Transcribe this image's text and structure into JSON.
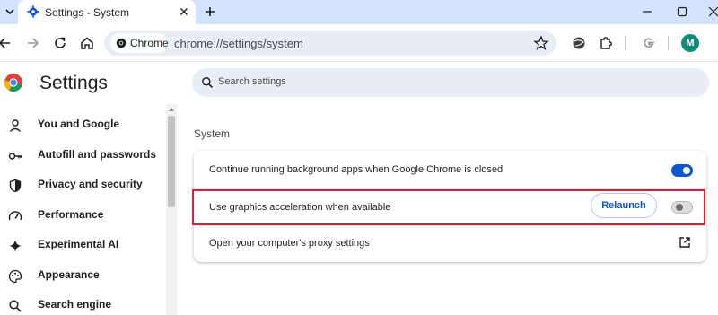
{
  "tab": {
    "title": "Settings - System"
  },
  "omnibox": {
    "chip_label": "Chrome",
    "url": "chrome://settings/system"
  },
  "profile": {
    "initial": "M"
  },
  "brand": {
    "title": "Settings"
  },
  "search": {
    "placeholder": "Search settings"
  },
  "sidebar": {
    "items": [
      {
        "label": "You and Google",
        "icon": "person-icon"
      },
      {
        "label": "Autofill and passwords",
        "icon": "key-icon"
      },
      {
        "label": "Privacy and security",
        "icon": "shield-icon"
      },
      {
        "label": "Performance",
        "icon": "speedometer-icon"
      },
      {
        "label": "Experimental AI",
        "icon": "sparkle-icon"
      },
      {
        "label": "Appearance",
        "icon": "palette-icon"
      },
      {
        "label": "Search engine",
        "icon": "search-icon"
      }
    ]
  },
  "main": {
    "section_title": "System",
    "rows": [
      {
        "label": "Continue running background apps when Google Chrome is closed",
        "toggle_on": true
      },
      {
        "label": "Use graphics acceleration when available",
        "toggle_on": false,
        "button_label": "Relaunch"
      },
      {
        "label": "Open your computer's proxy settings",
        "icon": "open-in-new-icon"
      }
    ]
  },
  "colors": {
    "accent": "#0b57d0",
    "highlight": "#d62134",
    "tabstrip": "#d3e3fd"
  }
}
